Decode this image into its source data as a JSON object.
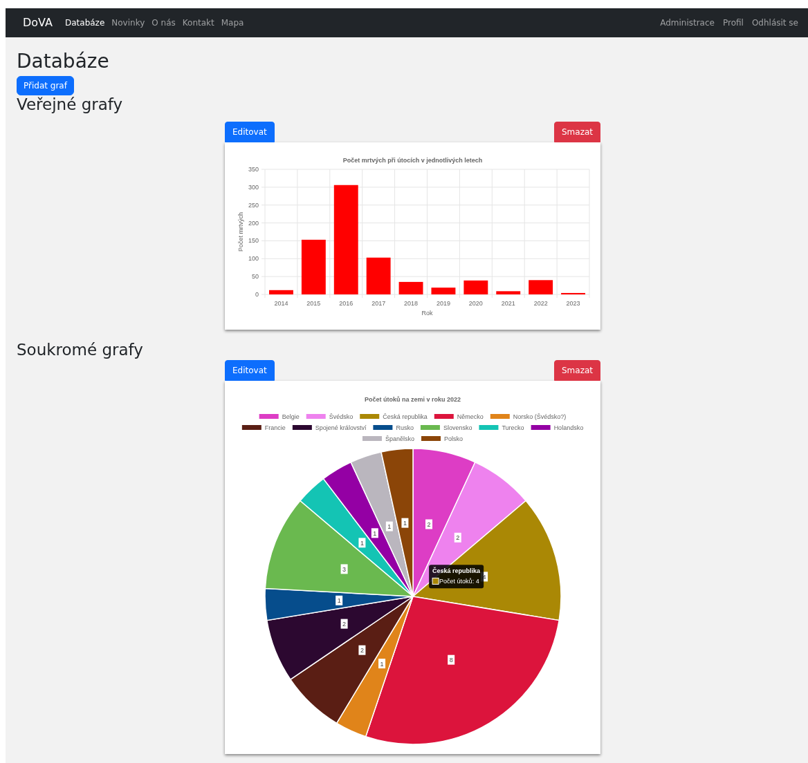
{
  "navbar": {
    "brand": "DoVA",
    "left_items": [
      {
        "label": "Databáze",
        "selected": true
      },
      {
        "label": "Novinky",
        "selected": false
      },
      {
        "label": "O nás",
        "selected": false
      },
      {
        "label": "Kontakt",
        "selected": false
      },
      {
        "label": "Mapa",
        "selected": false
      }
    ],
    "right_items": [
      {
        "label": "Administrace",
        "selected": false
      },
      {
        "label": "Profil",
        "selected": false
      },
      {
        "label": "Odhlásit se",
        "selected": false
      }
    ]
  },
  "title": "Databáze",
  "add_button": "Přidat graf",
  "sections": [
    {
      "heading": "Veřejné grafy",
      "edit_button": "Editovat",
      "delete_button": "Smazat",
      "chart_data": {
        "type": "bar",
        "title": "Počet mrtvých při útocích v jednotlivých letech",
        "xlabel": "Rok",
        "ylabel": "Počet mrtvých",
        "categories": [
          "2014",
          "2015",
          "2016",
          "2017",
          "2018",
          "2019",
          "2020",
          "2021",
          "2022",
          "2023"
        ],
        "color": "#ff0000",
        "values": [
          12,
          153,
          306,
          103,
          35,
          19,
          39,
          9,
          40,
          4
        ],
        "ylim": [
          0,
          350
        ],
        "yticks": [
          0,
          50,
          100,
          150,
          200,
          250,
          300,
          350
        ],
        "grid": true
      }
    },
    {
      "heading": "Soukromé grafy",
      "edit_button": "Editovat",
      "delete_button": "Smazat",
      "chart_data": {
        "type": "pie",
        "title": "Počet útoků na zemi v roku 2022",
        "categories": [
          "Belgie",
          "Švédsko",
          "Česká republika",
          "Německo",
          "Norsko (Švédsko?)",
          "Francie",
          "Spojené království",
          "Rusko",
          "Slovensko",
          "Turecko",
          "Holandsko",
          "Španělsko",
          "Polsko"
        ],
        "colors": [
          "#dd3dc5",
          "#ee82ee",
          "#aa8805",
          "#dc143c",
          "#e0841a",
          "#5a1e14",
          "#2c0830",
          "#064d8c",
          "#6ab94f",
          "#14c4b4",
          "#9400a4",
          "#bab6be",
          "#8b4508"
        ],
        "values": [
          2,
          2,
          4,
          8,
          1,
          2,
          2,
          1,
          3,
          1,
          1,
          1,
          1
        ],
        "data_labels": true,
        "legend": true
      },
      "tooltip": {
        "title": "Česká republika",
        "text": "Počet útoků: 4"
      }
    }
  ]
}
